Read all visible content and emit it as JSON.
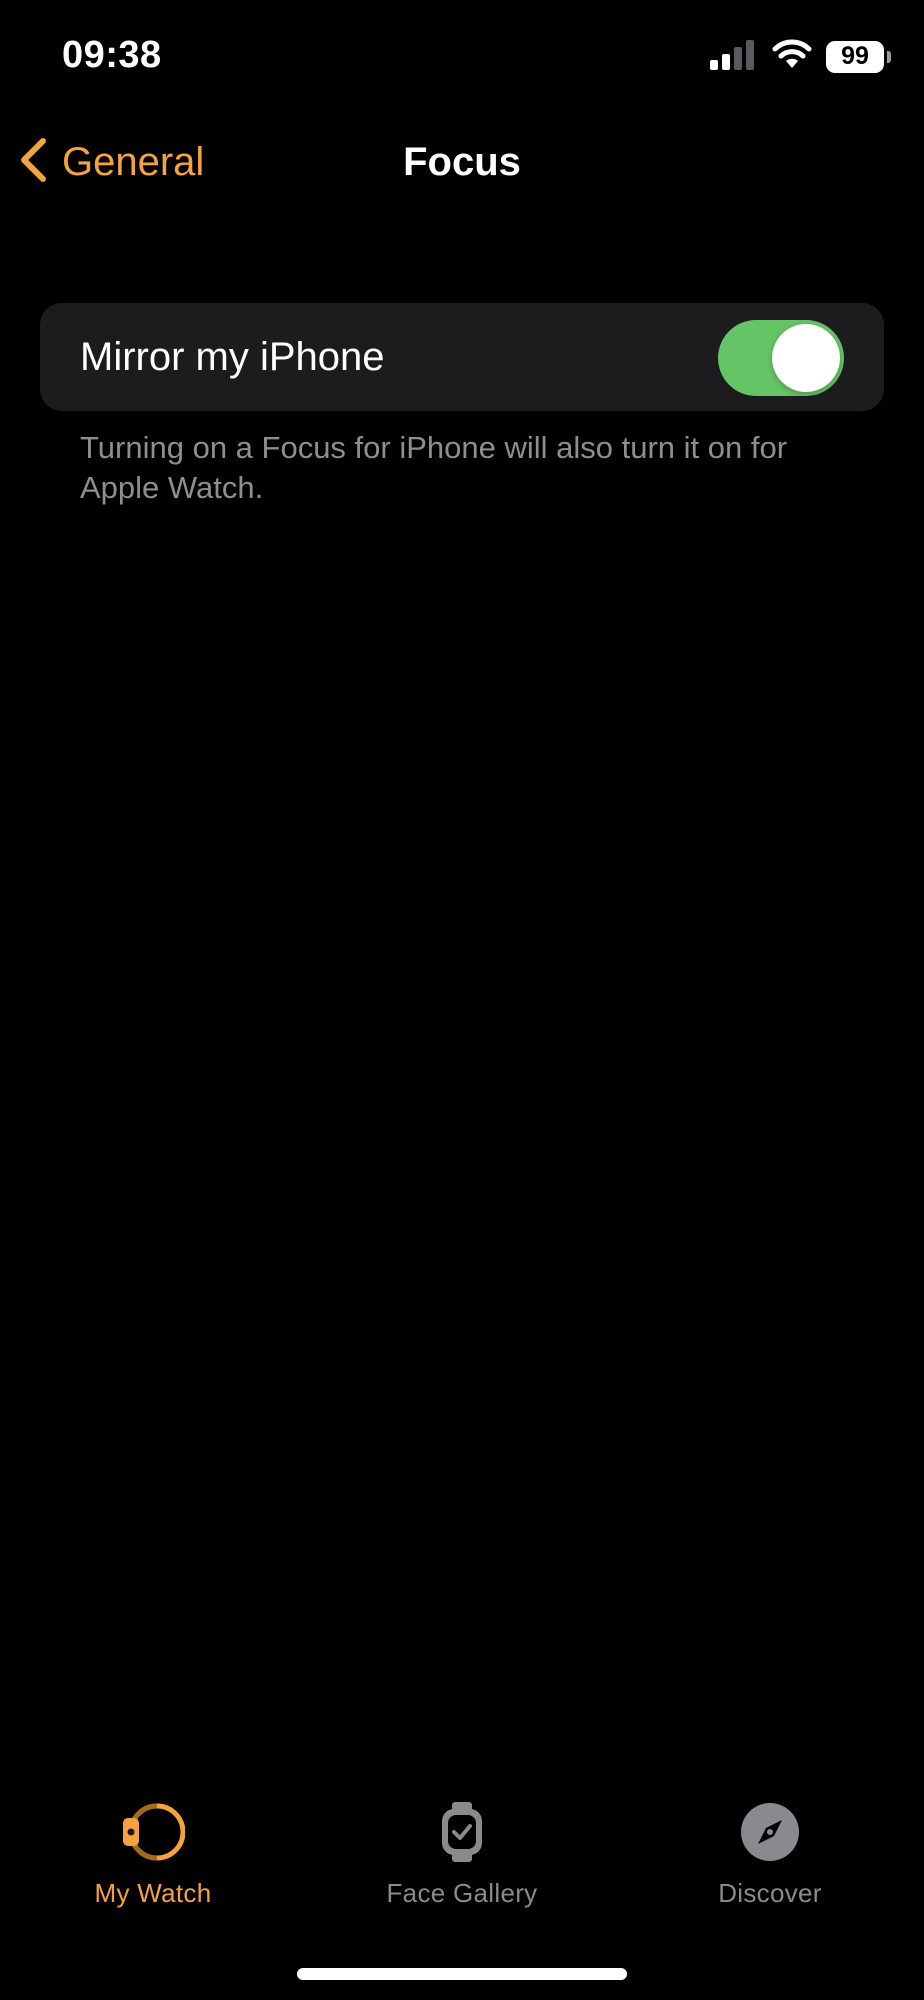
{
  "status_bar": {
    "time": "09:38",
    "battery": "99"
  },
  "nav": {
    "back_label": "General",
    "title": "Focus"
  },
  "settings": {
    "mirror_label": "Mirror my iPhone",
    "mirror_enabled": true,
    "footnote": "Turning on a Focus for iPhone will also turn it on for Apple Watch."
  },
  "tabs": [
    {
      "label": "My Watch",
      "icon": "watch-icon",
      "active": true
    },
    {
      "label": "Face Gallery",
      "icon": "face-gallery-icon",
      "active": false
    },
    {
      "label": "Discover",
      "icon": "compass-icon",
      "active": false
    }
  ],
  "colors": {
    "accent": "#f5a33d",
    "toggle_on": "#65c466",
    "group_bg": "#1c1c1e",
    "secondary_text": "#8d8d92"
  }
}
